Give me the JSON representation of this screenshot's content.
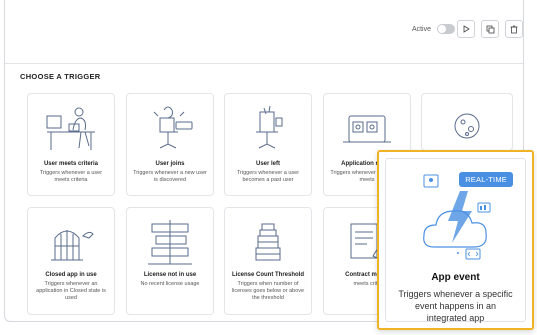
{
  "toolbar": {
    "active_label": "Active",
    "play_icon": "play-icon",
    "copy_icon": "copy-icon",
    "delete_icon": "trash-icon"
  },
  "section_title": "CHOOSE A TRIGGER",
  "cards": [
    {
      "title": "User meets criteria",
      "desc": "Triggers whenever a user meets criteria"
    },
    {
      "title": "User joins",
      "desc": "Triggers whenever a new user is discovered"
    },
    {
      "title": "User left",
      "desc": "Triggers whenever a user becomes a past user"
    },
    {
      "title": "Application meets",
      "desc": "Triggers whenever application meets"
    },
    {
      "title": "Closed app in use",
      "desc": "Triggers whenever an application in Closed state is used"
    },
    {
      "title": "License not in use",
      "desc": "No recent license usage"
    },
    {
      "title": "License Count Threshold",
      "desc": "Triggers when number of licenses goes below or above the threshold"
    },
    {
      "title": "Contract meets",
      "desc": "meets crite"
    }
  ],
  "popup": {
    "badge": "REAL-TIME",
    "title": "App event",
    "desc": "Triggers whenever a specific event happens in an integrated app"
  },
  "colors": {
    "accent": "#4a90e2",
    "highlight": "#f0b323",
    "illustration": "#5a6b8c"
  }
}
